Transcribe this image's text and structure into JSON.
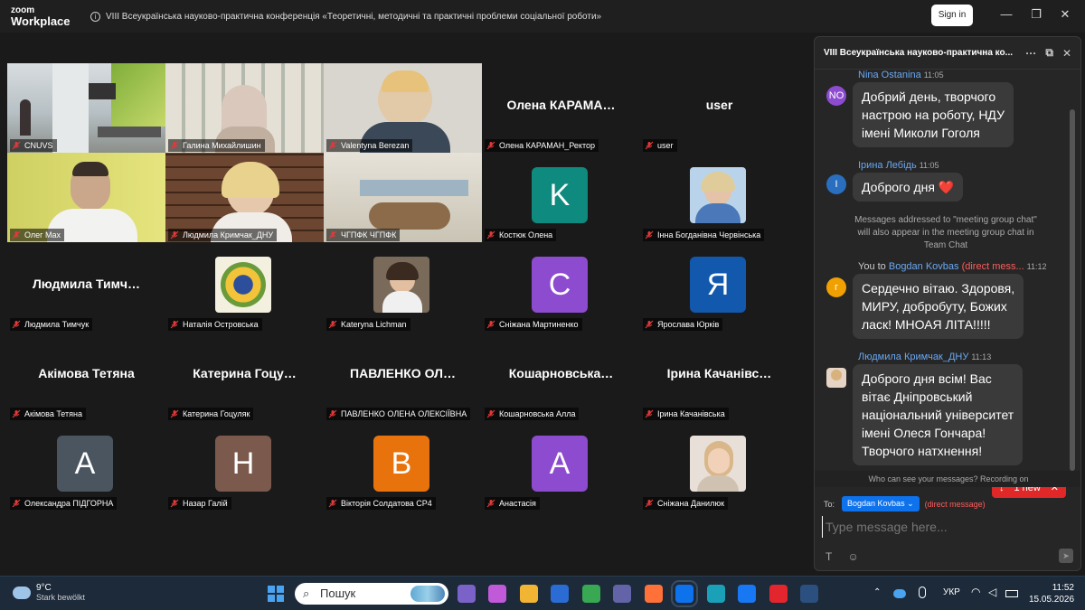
{
  "app": {
    "logo_top": "zoom",
    "logo_bottom": "Workplace"
  },
  "window": {
    "title": "VIII Всеукраїнська науково-практична конференція «Теоретичні, методичні та практичні проблеми соціальної роботи»",
    "info_glyph": "i",
    "sign_in": "Sign in",
    "minimize_glyph": "—",
    "restore_glyph": "❐",
    "close_glyph": "✕"
  },
  "grid": {
    "row1": [
      {
        "name": "CNUVS",
        "kind": "video"
      },
      {
        "name": "Галина Михайлишин",
        "kind": "video"
      },
      {
        "name": "Valentyna Berezan",
        "kind": "video"
      },
      {
        "name": "Олена КАРАМАН_Ректор",
        "kind": "name",
        "display": "Олена  КАРАМА…"
      },
      {
        "name": "user",
        "kind": "name",
        "display": "user"
      }
    ],
    "row2": [
      {
        "name": "Олег Мах",
        "kind": "video"
      },
      {
        "name": "Людмила Кримчак_ДНУ",
        "kind": "video"
      },
      {
        "name": "ЧГПФК ЧГПФК",
        "kind": "video"
      },
      {
        "name": "Костюк Олена",
        "kind": "avatar",
        "letter": "K",
        "color": "#0f8a7e"
      },
      {
        "name": "Інна Богданівна Червінська",
        "kind": "photo"
      }
    ],
    "row3": [
      {
        "name": "Людмила Тимчук",
        "kind": "name",
        "display": "Людмила  Тимч…"
      },
      {
        "name": "Наталія Островська",
        "kind": "photo"
      },
      {
        "name": "Kateryna Lichman",
        "kind": "photo"
      },
      {
        "name": "Сніжана Мартиненко",
        "kind": "avatar",
        "letter": "C",
        "color": "#8d4bd0"
      },
      {
        "name": "Ярослава Юрків",
        "kind": "avatar",
        "letter": "Я",
        "color": "#1258ad"
      }
    ],
    "row4": [
      {
        "name": "Акімова Тетяна",
        "kind": "name",
        "display": "Акімова Тетяна"
      },
      {
        "name": "Катерина Гоцуляк",
        "kind": "name",
        "display": "Катерина  Гоцу…"
      },
      {
        "name": "ПАВЛЕНКО ОЛЕНА ОЛЕКСІЇВНА",
        "kind": "name",
        "display": "ПАВЛЕНКО  ОЛ…"
      },
      {
        "name": "Кошарновська Алла",
        "kind": "name",
        "display": "Кошарновська…"
      },
      {
        "name": "Ірина Качанівська",
        "kind": "name",
        "display": "Ірина  Качанівс…"
      }
    ],
    "row5": [
      {
        "name": "Олександра ПІДГОРНА",
        "kind": "avatar",
        "letter": "A",
        "color": "#4a5560"
      },
      {
        "name": "Назар Галій",
        "kind": "avatar",
        "letter": "H",
        "color": "#7b5a4d"
      },
      {
        "name": "Вікторія Солдатова СР4",
        "kind": "avatar",
        "letter": "B",
        "color": "#e8730d"
      },
      {
        "name": "Анастасія",
        "kind": "avatar",
        "letter": "A",
        "color": "#8d4bd0"
      },
      {
        "name": "Сніжана Данилюк",
        "kind": "photo"
      }
    ]
  },
  "chat": {
    "header": "VIII Всеукраїнська науково-практична ко...",
    "more_glyph": "···",
    "popout_glyph": "⧉",
    "close_glyph": "✕",
    "messages": [
      {
        "sender": "Nina Ostanina",
        "time": "11:05",
        "avatar": "NO",
        "avatar_color": "#8d4bd0",
        "text_lines": [
          "Добрий день, творчого",
          "настрою на роботу, НДУ",
          "імені Миколи Гоголя"
        ]
      },
      {
        "sender": "Ірина Лебідь",
        "time": "11:05",
        "avatar": "I",
        "avatar_color": "#2a6fbf",
        "text_lines": [
          "Доброго дня ❤️"
        ]
      },
      {
        "sender_prefix": "You to",
        "sender": "Bogdan Kovbas",
        "dm_label": "(direct mess...",
        "time": "11:12",
        "avatar": "г",
        "avatar_color": "#f0a000",
        "text_lines": [
          "Сердечно вітаю. Здоровя,",
          "МИРУ, добробуту, Божих",
          "ласк! МНОАЯ ЛІТА!!!!!"
        ]
      },
      {
        "sender": "Людмила Кримчак_ДНУ",
        "time": "11:13",
        "text_lines": [
          "Доброго дня всім! Вас",
          "вітає Дніпровський",
          "національний університет",
          "імені Олеся Гончара!",
          "Творчого натхнення!"
        ]
      }
    ],
    "system_note": "Messages addressed to \"meeting group chat\" will also appear in the meeting group chat in Team Chat",
    "new_badge": "1 new",
    "new_arrow": "↓",
    "new_close": "✕",
    "who_can_see": "Who can see your messages? Recording on",
    "to_label": "To:",
    "to_recipient": "Bogdan Kovbas ⌄",
    "dm_note": "(direct message)",
    "placeholder": "Type message here...",
    "format_glyph": "T",
    "emoji_glyph": "☺",
    "send_glyph": "➤"
  },
  "taskbar": {
    "temp": "9°C",
    "weather": "Stark bewölkt",
    "search": "Пошук",
    "search_glyph": "⌕",
    "tray_chevron": "⌃",
    "lang": "УКР",
    "time": "11:52",
    "date": "15.05.2026",
    "apps": [
      {
        "icon": "viber-icon",
        "color": "#7b62c9"
      },
      {
        "icon": "copilot-icon",
        "color": "#c05ad8"
      },
      {
        "icon": "file-explorer-icon",
        "color": "#f2b533"
      },
      {
        "icon": "word-icon",
        "color": "#2b6cd4"
      },
      {
        "icon": "chrome-icon",
        "color": "#38a852"
      },
      {
        "icon": "teams-icon",
        "color": "#6264a7"
      },
      {
        "icon": "firefox-icon",
        "color": "#ff7139"
      },
      {
        "icon": "zoom-icon",
        "color": "#0e72ed"
      },
      {
        "icon": "edge-icon",
        "color": "#1aa1b8"
      },
      {
        "icon": "facebook-icon",
        "color": "#1877f2"
      },
      {
        "icon": "wps-icon",
        "color": "#e3262d"
      },
      {
        "icon": "photos-icon",
        "color": "#2b4f7e"
      }
    ]
  }
}
